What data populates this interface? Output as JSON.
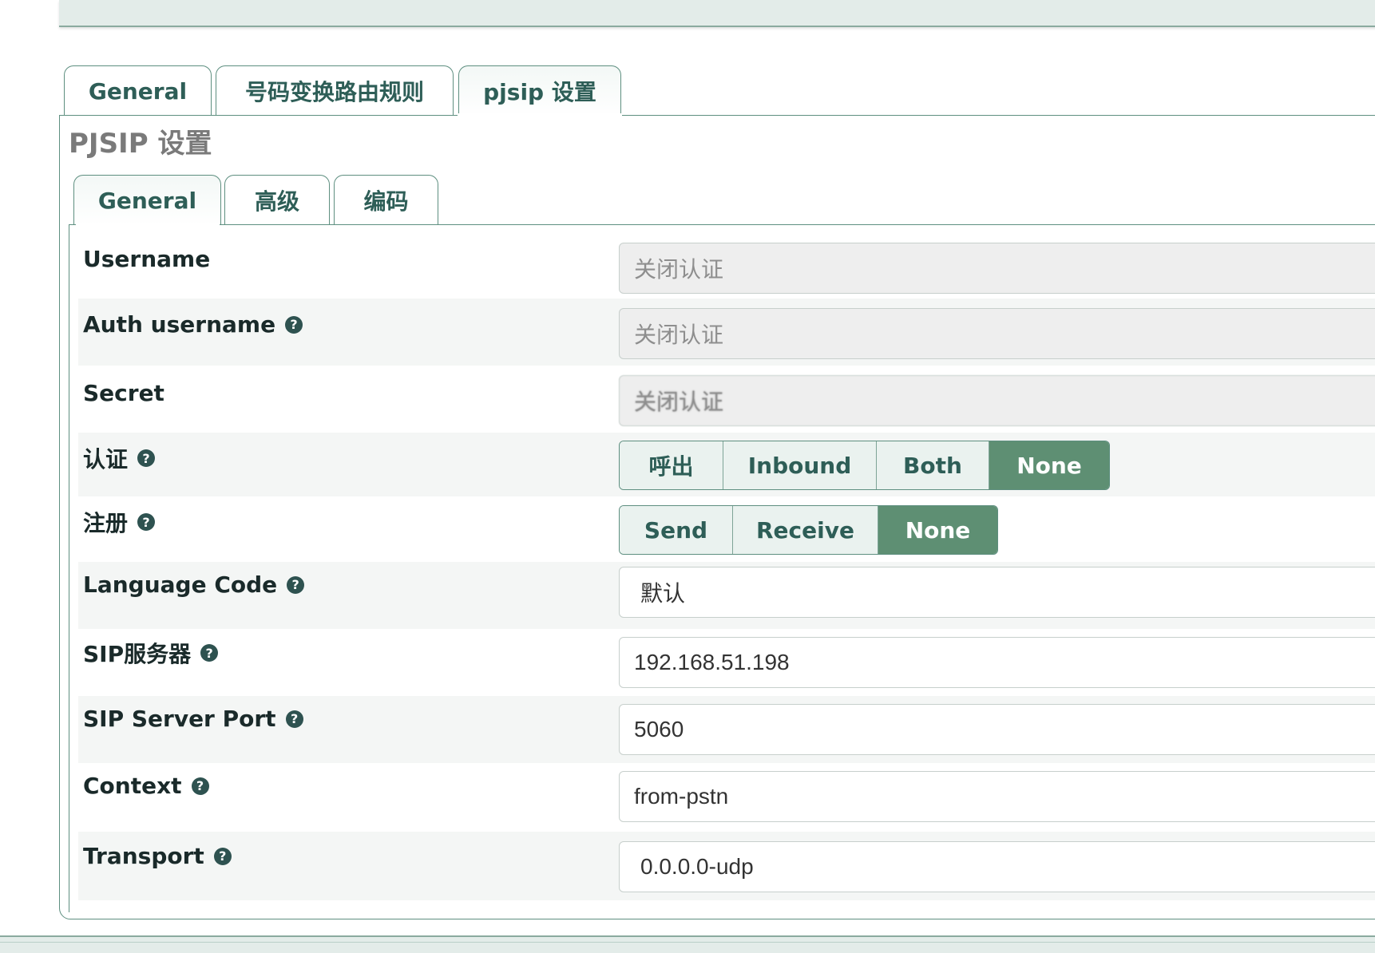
{
  "outer_tabs": [
    {
      "label": "General"
    },
    {
      "label": "号码变换路由规则"
    },
    {
      "label": "pjsip 设置",
      "active": true
    }
  ],
  "panel_title": "PJSIP 设置",
  "inner_tabs": [
    {
      "label": "General",
      "active": true
    },
    {
      "label": "高级"
    },
    {
      "label": "编码"
    }
  ],
  "form": {
    "username": {
      "label": "Username",
      "value": "关闭认证",
      "disabled": true
    },
    "auth_username": {
      "label": "Auth username",
      "value": "关闭认证",
      "disabled": true
    },
    "secret": {
      "label": "Secret",
      "value": "关闭认证",
      "disabled": true
    },
    "auth": {
      "label": "认证",
      "options": [
        "呼出",
        "Inbound",
        "Both",
        "None"
      ],
      "selected": "None"
    },
    "registration": {
      "label": "注册",
      "options": [
        "Send",
        "Receive",
        "None"
      ],
      "selected": "None"
    },
    "language_code": {
      "label": "Language Code",
      "value": "默认"
    },
    "sip_server": {
      "label": "SIP服务器",
      "value": "192.168.51.198"
    },
    "sip_server_port": {
      "label": "SIP Server Port",
      "value": "5060"
    },
    "context": {
      "label": "Context",
      "value": "from-pstn"
    },
    "transport": {
      "label": "Transport",
      "value": "0.0.0.0-udp"
    }
  },
  "icons": {
    "help": "question-circle-icon"
  },
  "help_glyph": "?",
  "colors": {
    "accent": "#5e8f73",
    "tab_text": "#2e5e57",
    "border": "#5e8f80"
  }
}
